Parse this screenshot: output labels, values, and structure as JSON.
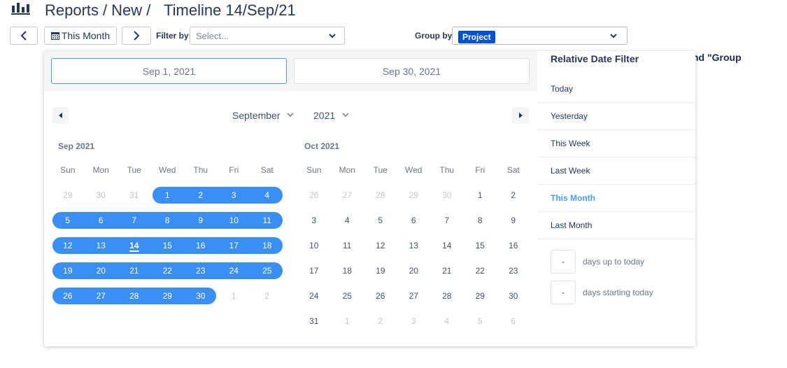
{
  "header": {
    "logo_icon": "bar-chart-icon",
    "breadcrumb": [
      "Reports",
      "New"
    ],
    "separator": "/",
    "title": "Timeline 14/Sep/21"
  },
  "toolbar": {
    "prev_icon": "chevron-left-icon",
    "period_label": "This Month",
    "period_icon": "calendar-icon",
    "next_icon": "chevron-right-icon",
    "filter_label": "Filter by:",
    "filter_placeholder": "Select...",
    "group_label": "Group by:",
    "group_value": "Project"
  },
  "background_text": "nd \"Group",
  "popup": {
    "start_date": "Sep 1, 2021",
    "end_date": "Sep 30, 2021",
    "month_select": "September",
    "year_select": "2021",
    "weekdays": [
      "Sun",
      "Mon",
      "Tue",
      "Wed",
      "Thu",
      "Fri",
      "Sat"
    ],
    "calendars": [
      {
        "title": "Sep 2021",
        "days": [
          {
            "d": "29",
            "o": true
          },
          {
            "d": "30",
            "o": true
          },
          {
            "d": "31",
            "o": true
          },
          {
            "d": "1",
            "s": true
          },
          {
            "d": "2",
            "s": true
          },
          {
            "d": "3",
            "s": true
          },
          {
            "d": "4",
            "s": true
          },
          {
            "d": "5",
            "s": true
          },
          {
            "d": "6",
            "s": true
          },
          {
            "d": "7",
            "s": true
          },
          {
            "d": "8",
            "s": true
          },
          {
            "d": "9",
            "s": true
          },
          {
            "d": "10",
            "s": true
          },
          {
            "d": "11",
            "s": true
          },
          {
            "d": "12",
            "s": true
          },
          {
            "d": "13",
            "s": true
          },
          {
            "d": "14",
            "s": true,
            "t": true
          },
          {
            "d": "15",
            "s": true
          },
          {
            "d": "16",
            "s": true
          },
          {
            "d": "17",
            "s": true
          },
          {
            "d": "18",
            "s": true
          },
          {
            "d": "19",
            "s": true
          },
          {
            "d": "20",
            "s": true
          },
          {
            "d": "21",
            "s": true
          },
          {
            "d": "22",
            "s": true
          },
          {
            "d": "23",
            "s": true
          },
          {
            "d": "24",
            "s": true
          },
          {
            "d": "25",
            "s": true
          },
          {
            "d": "26",
            "s": true
          },
          {
            "d": "27",
            "s": true
          },
          {
            "d": "28",
            "s": true
          },
          {
            "d": "29",
            "s": true
          },
          {
            "d": "30",
            "s": true
          },
          {
            "d": "1",
            "o": true
          },
          {
            "d": "2",
            "o": true
          }
        ]
      },
      {
        "title": "Oct 2021",
        "days": [
          {
            "d": "26",
            "o": true
          },
          {
            "d": "27",
            "o": true
          },
          {
            "d": "28",
            "o": true
          },
          {
            "d": "29",
            "o": true
          },
          {
            "d": "30",
            "o": true
          },
          {
            "d": "1"
          },
          {
            "d": "2"
          },
          {
            "d": "3"
          },
          {
            "d": "4"
          },
          {
            "d": "5"
          },
          {
            "d": "6"
          },
          {
            "d": "7"
          },
          {
            "d": "8"
          },
          {
            "d": "9"
          },
          {
            "d": "10"
          },
          {
            "d": "11"
          },
          {
            "d": "12"
          },
          {
            "d": "13"
          },
          {
            "d": "14"
          },
          {
            "d": "15"
          },
          {
            "d": "16"
          },
          {
            "d": "17"
          },
          {
            "d": "18"
          },
          {
            "d": "19"
          },
          {
            "d": "20"
          },
          {
            "d": "21"
          },
          {
            "d": "22"
          },
          {
            "d": "23"
          },
          {
            "d": "24"
          },
          {
            "d": "25"
          },
          {
            "d": "26"
          },
          {
            "d": "27"
          },
          {
            "d": "28"
          },
          {
            "d": "29"
          },
          {
            "d": "30"
          },
          {
            "d": "31"
          },
          {
            "d": "1",
            "o": true
          },
          {
            "d": "2",
            "o": true
          },
          {
            "d": "3",
            "o": true
          },
          {
            "d": "4",
            "o": true
          },
          {
            "d": "5",
            "o": true
          },
          {
            "d": "6",
            "o": true
          }
        ]
      }
    ],
    "relative": {
      "title": "Relative Date Filter",
      "items": [
        "Today",
        "Yesterday",
        "This Week",
        "Last Week",
        "This Month",
        "Last Month"
      ],
      "active": "This Month",
      "days_up_value": "-",
      "days_up_label": "days up to today",
      "days_start_value": "-",
      "days_start_label": "days starting today"
    }
  },
  "colors": {
    "accent": "#3b8ef3",
    "active_link": "#4c9aff",
    "tag": "#0052cc",
    "text": "#253858"
  }
}
